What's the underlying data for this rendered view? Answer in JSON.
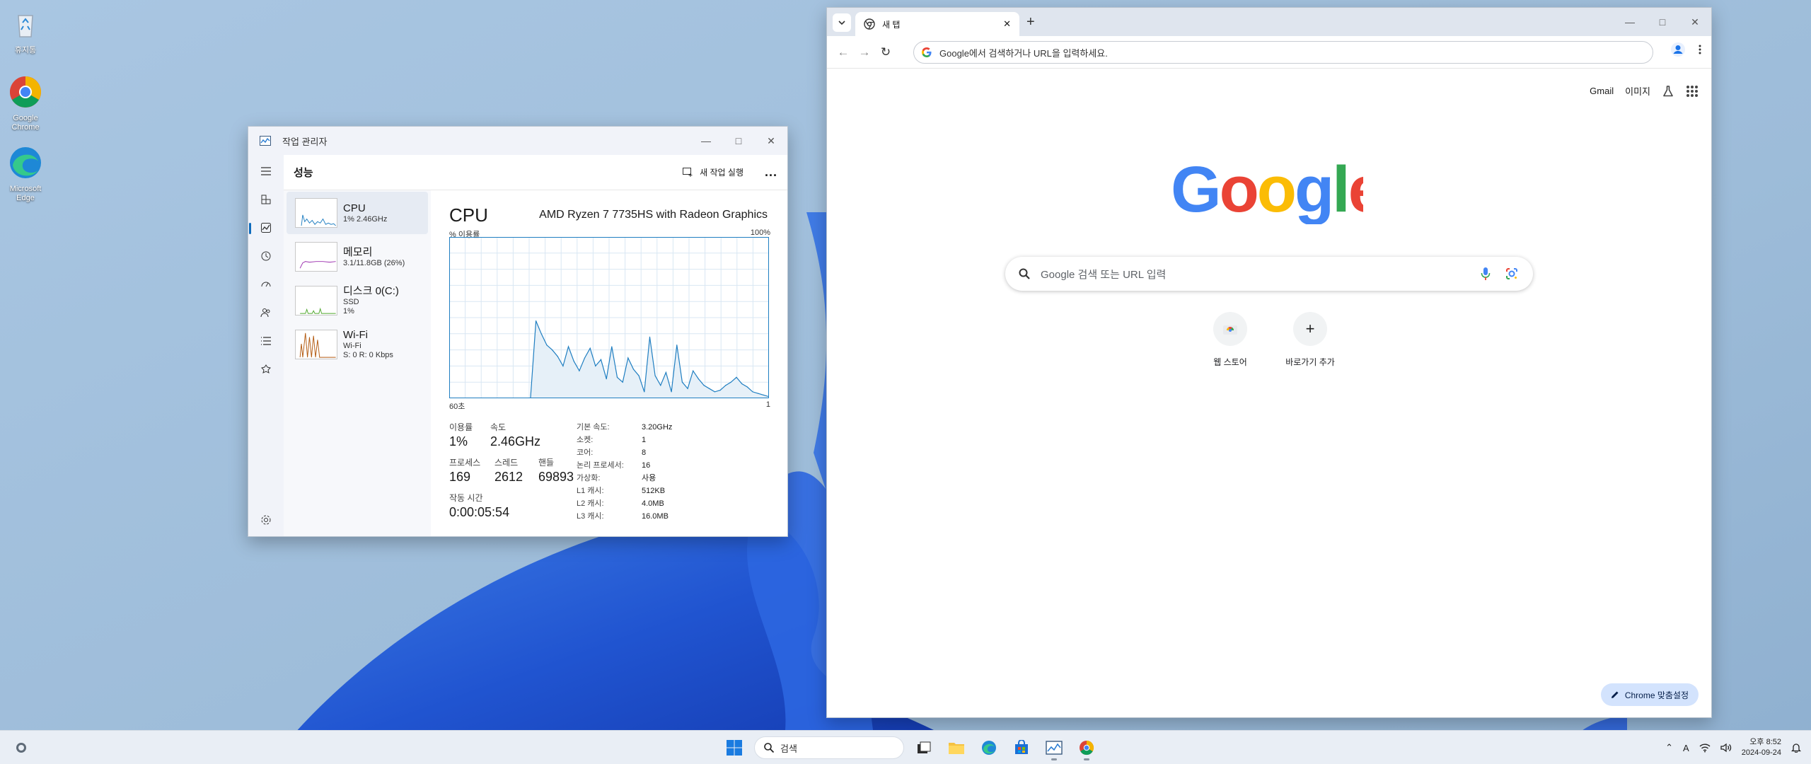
{
  "desktop": {
    "icons": [
      {
        "label": "휴지통",
        "icon": "recycle-bin-icon"
      },
      {
        "label": "Google Chrome",
        "icon": "chrome-icon"
      },
      {
        "label": "Microsoft Edge",
        "icon": "edge-icon"
      }
    ]
  },
  "task_manager": {
    "title": "작업 관리자",
    "page_title": "성능",
    "new_task_label": "새 작업 실행",
    "more_label": "...",
    "resources": [
      {
        "name": "CPU",
        "sub1": "1% 2.46GHz",
        "sub2": "",
        "color": "#1f7ec1"
      },
      {
        "name": "메모리",
        "sub1": "3.1/11.8GB (26%)",
        "sub2": "",
        "color": "#9b2fae"
      },
      {
        "name": "디스크 0(C:)",
        "sub1": "SSD",
        "sub2": "1%",
        "color": "#4ea72c"
      },
      {
        "name": "Wi-Fi",
        "sub1": "Wi-Fi",
        "sub2": "S: 0 R: 0 Kbps",
        "color": "#b35a10"
      }
    ],
    "detail": {
      "heading": "CPU",
      "cpu_model": "AMD Ryzen 7 7735HS with Radeon Graphics",
      "y_label": "% 이용률",
      "y_max_label": "100%",
      "x_left_label": "60초",
      "x_right_label": "1",
      "utilization_label": "이용률",
      "utilization_value": "1%",
      "speed_label": "속도",
      "speed_value": "2.46GHz",
      "processes_label": "프로세스",
      "processes_value": "169",
      "threads_label": "스레드",
      "threads_value": "2612",
      "handles_label": "핸들",
      "handles_value": "69893",
      "uptime_label": "작동 시간",
      "uptime_value": "0:00:05:54",
      "specs": [
        {
          "k": "기본 속도:",
          "v": "3.20GHz"
        },
        {
          "k": "소켓:",
          "v": "1"
        },
        {
          "k": "코어:",
          "v": "8"
        },
        {
          "k": "논리 프로세서:",
          "v": "16"
        },
        {
          "k": "가상화:",
          "v": "사용"
        },
        {
          "k": "L1 캐시:",
          "v": "512KB"
        },
        {
          "k": "L2 캐시:",
          "v": "4.0MB"
        },
        {
          "k": "L3 캐시:",
          "v": "16.0MB"
        }
      ]
    }
  },
  "chart_data": {
    "type": "area",
    "title": "CPU",
    "ylabel": "% 이용률",
    "xlabel": "",
    "x": [
      60,
      59,
      58,
      57,
      56,
      55,
      54,
      53,
      52,
      51,
      50,
      49,
      48,
      47,
      46,
      45,
      44,
      43,
      42,
      41,
      40,
      39,
      38,
      37,
      36,
      35,
      34,
      33,
      32,
      31,
      30,
      29,
      28,
      27,
      26,
      25,
      24,
      23,
      22,
      21,
      20,
      19,
      18,
      17,
      16,
      15,
      14,
      13,
      12,
      11,
      10,
      9,
      8,
      7,
      6,
      5,
      4,
      3,
      2,
      1
    ],
    "xlim": [
      60,
      1
    ],
    "ylim": [
      0,
      100
    ],
    "grid": true,
    "series": [
      {
        "values": [
          0,
          0,
          0,
          0,
          0,
          0,
          0,
          0,
          0,
          0,
          0,
          0,
          0,
          0,
          0,
          0,
          48,
          40,
          33,
          30,
          26,
          20,
          32,
          23,
          17,
          25,
          31,
          20,
          24,
          12,
          32,
          13,
          10,
          25,
          18,
          14,
          4,
          38,
          14,
          8,
          16,
          4,
          33,
          10,
          6,
          17,
          12,
          8,
          6,
          4,
          5,
          8,
          10,
          13,
          9,
          7,
          4,
          3,
          2,
          1
        ]
      }
    ]
  },
  "chrome": {
    "tab_title": "새 탭",
    "omnibox_text": "Google에서 검색하거나 URL을 입력하세요.",
    "gmail_label": "Gmail",
    "images_label": "이미지",
    "search_placeholder": "Google 검색 또는 URL 입력",
    "shortcuts": [
      {
        "label": "웹 스토어"
      },
      {
        "label": "바로가기 추가"
      }
    ],
    "customize_label": "Chrome 맞춤설정"
  },
  "taskbar": {
    "search_label": "검색",
    "clock_time": "오후 8:52",
    "clock_date": "2024-09-24",
    "ime_label": "A"
  }
}
